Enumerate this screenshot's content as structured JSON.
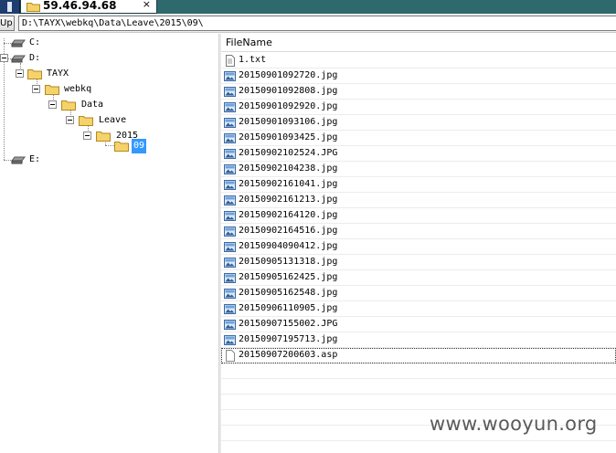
{
  "tab": {
    "title": "59.46.94.68",
    "close": "×"
  },
  "toolbar": {
    "up_label": "Up",
    "path": "D:\\TAYX\\webkq\\Data\\Leave\\2015\\09\\"
  },
  "tree": {
    "nodes": [
      {
        "label": "C:",
        "icon": "drive-icon"
      },
      {
        "label": "D:",
        "icon": "drive-icon"
      },
      {
        "label": "TAYX",
        "icon": "folder-icon"
      },
      {
        "label": "webkq",
        "icon": "folder-icon"
      },
      {
        "label": "Data",
        "icon": "folder-icon"
      },
      {
        "label": "Leave",
        "icon": "folder-icon"
      },
      {
        "label": "2015",
        "icon": "folder-icon"
      },
      {
        "label": "09",
        "icon": "folder-icon",
        "selected": true
      },
      {
        "label": "E:",
        "icon": "drive-icon"
      }
    ]
  },
  "filelist": {
    "header": "FileName",
    "files": [
      {
        "name": "1.txt",
        "icon": "text-file-icon"
      },
      {
        "name": "20150901092720.jpg",
        "icon": "image-file-icon"
      },
      {
        "name": "20150901092808.jpg",
        "icon": "image-file-icon"
      },
      {
        "name": "20150901092920.jpg",
        "icon": "image-file-icon"
      },
      {
        "name": "20150901093106.jpg",
        "icon": "image-file-icon"
      },
      {
        "name": "20150901093425.jpg",
        "icon": "image-file-icon"
      },
      {
        "name": "20150902102524.JPG",
        "icon": "image-file-icon"
      },
      {
        "name": "20150902104238.jpg",
        "icon": "image-file-icon"
      },
      {
        "name": "20150902161041.jpg",
        "icon": "image-file-icon"
      },
      {
        "name": "20150902161213.jpg",
        "icon": "image-file-icon"
      },
      {
        "name": "20150902164120.jpg",
        "icon": "image-file-icon"
      },
      {
        "name": "20150902164516.jpg",
        "icon": "image-file-icon"
      },
      {
        "name": "20150904090412.jpg",
        "icon": "image-file-icon"
      },
      {
        "name": "20150905131318.jpg",
        "icon": "image-file-icon"
      },
      {
        "name": "20150905162425.jpg",
        "icon": "image-file-icon"
      },
      {
        "name": "20150905162548.jpg",
        "icon": "image-file-icon"
      },
      {
        "name": "20150906110905.jpg",
        "icon": "image-file-icon"
      },
      {
        "name": "20150907155002.JPG",
        "icon": "image-file-icon"
      },
      {
        "name": "20150907195713.jpg",
        "icon": "image-file-icon"
      },
      {
        "name": "20150907200603.asp",
        "icon": "blank-file-icon",
        "focused": true
      }
    ]
  },
  "watermark": "www.wooyun.org",
  "colors": {
    "tabbar": "#2e6a6d",
    "selection": "#3399ff",
    "folder": "#f6d26a"
  }
}
